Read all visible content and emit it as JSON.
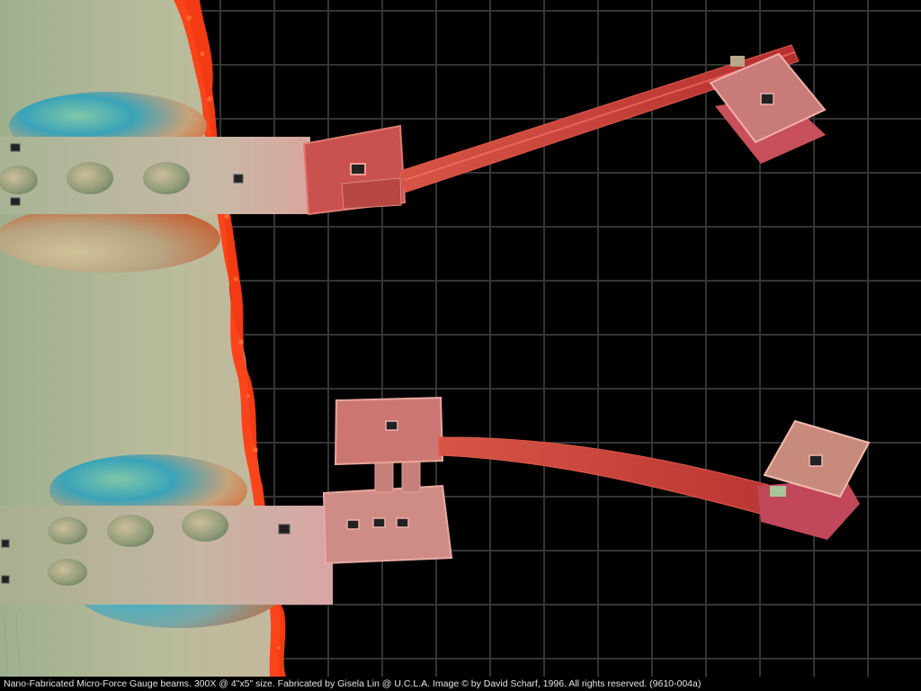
{
  "caption": "Nano-Fabricated Micro-Force Gauge beams. 300X @ 4\"x5\" size. Fabricated by Gisela Lin @ U.C.L.A.   Image © by David Scharf, 1996. All rights reserved. (9610-004a)",
  "colors": {
    "background": "#000000",
    "grid": "#3a3a3a",
    "substrate": "#b7bd9a",
    "edge": "#ff3a12",
    "beam": "#c94040",
    "pad": "#cf7a72"
  }
}
